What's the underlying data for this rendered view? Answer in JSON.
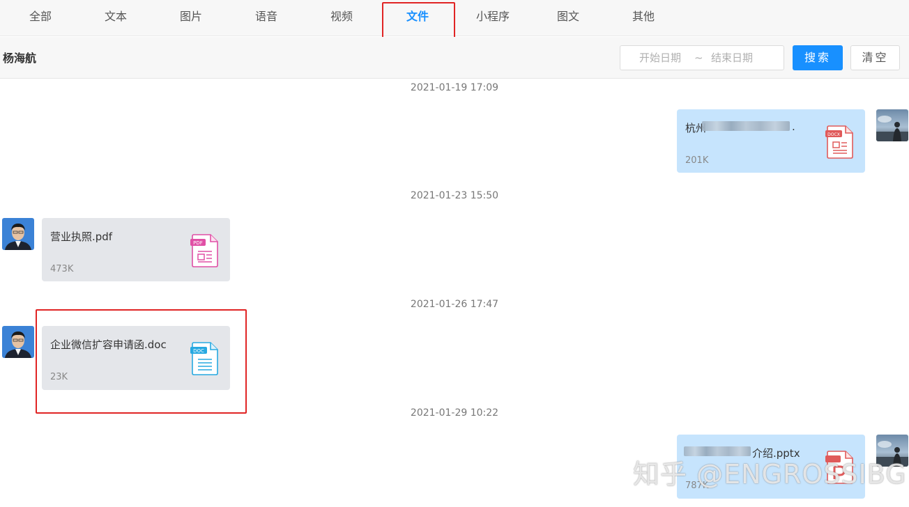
{
  "tabs": [
    {
      "label": "全部"
    },
    {
      "label": "文本"
    },
    {
      "label": "图片"
    },
    {
      "label": "语音"
    },
    {
      "label": "视频"
    },
    {
      "label": "文件",
      "active": true
    },
    {
      "label": "小程序"
    },
    {
      "label": "图文"
    },
    {
      "label": "其他"
    }
  ],
  "toolbar": {
    "contact_name": "杨海航",
    "start_placeholder": "开始日期",
    "separator": "~",
    "end_placeholder": "结束日期",
    "search_label": "搜索",
    "clear_label": "清空"
  },
  "messages": [
    {
      "timestamp": "2021-01-19 17:09",
      "sender": "self",
      "file_name_visible": "杭州",
      "file_name_tail": ".",
      "size": "201K",
      "file_type": "DOCX",
      "icon": "docx-file-icon"
    },
    {
      "timestamp": "2021-01-23 15:50",
      "sender": "contact",
      "file_name": "营业执照.pdf",
      "size": "473K",
      "file_type": "PDF",
      "icon": "pdf-file-icon"
    },
    {
      "timestamp": "2021-01-26 17:47",
      "sender": "contact",
      "file_name": "企业微信扩容申请函.doc",
      "size": "23K",
      "file_type": "DOC",
      "icon": "doc-file-icon"
    },
    {
      "timestamp": "2021-01-29 10:22",
      "sender": "self",
      "file_name_visible": "介绍.pptx",
      "size": "787K",
      "file_type": "PPT",
      "icon": "pptx-file-icon"
    }
  ],
  "watermark": "知乎 @ENGROSSIBG",
  "colors": {
    "accent": "#1890ff",
    "bubble_self": "#c6e4fd",
    "bubble_contact": "#e4e6ea",
    "highlight": "#e02424",
    "docx_icon": "#e05a5a",
    "pdf_icon": "#e04fa5",
    "doc_icon": "#27a9e1"
  }
}
